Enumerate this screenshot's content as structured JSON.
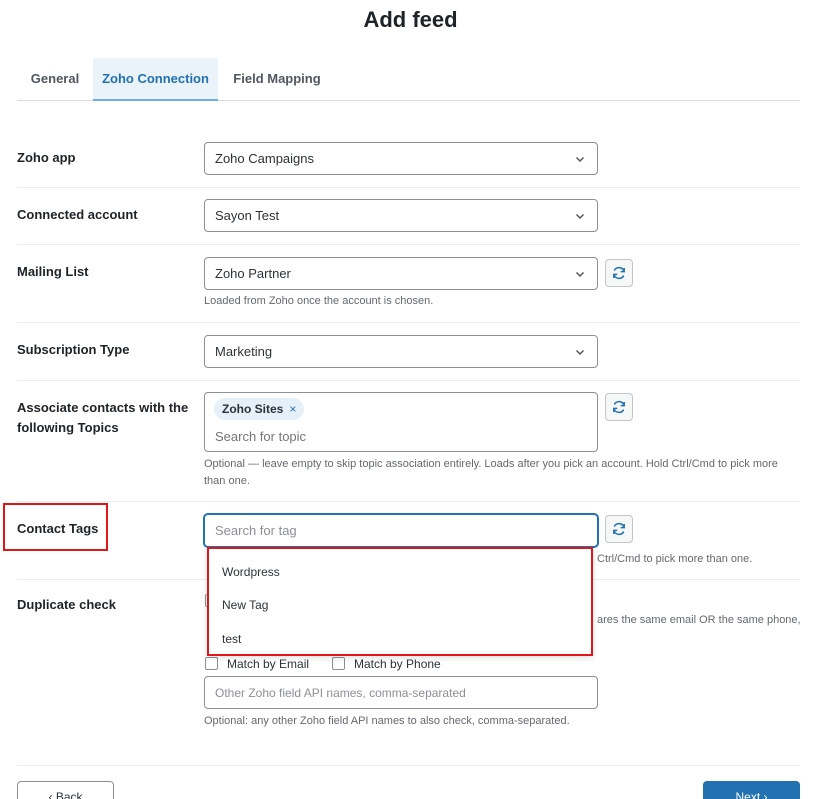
{
  "header": {
    "title": "Add feed"
  },
  "tabs": [
    {
      "label": "General"
    },
    {
      "label": "Zoho Connection"
    },
    {
      "label": "Field Mapping"
    }
  ],
  "fields": {
    "zoho_app": {
      "label": "Zoho app",
      "value": "Zoho Campaigns"
    },
    "connected_account": {
      "label": "Connected account",
      "value": "Sayon Test"
    },
    "mailing_list": {
      "label": "Mailing List",
      "value": "Zoho Partner",
      "help": "Loaded from Zoho once the account is chosen."
    },
    "subscription_type": {
      "label": "Subscription Type",
      "value": "Marketing"
    },
    "topics": {
      "label_line1": "Associate contacts with the",
      "label_line2": "following Topics",
      "chip": "Zoho Sites",
      "chip_remove": "×",
      "placeholder": "Search for topic",
      "help_line1": "Optional — leave empty to skip topic association entirely. Loads after you pick an account. Hold Ctrl/Cmd to pick more",
      "help_line2": "than one."
    },
    "contact_tags": {
      "label": "Contact Tags",
      "placeholder": "Search for tag",
      "help_visible": "Ctrl/Cmd to pick more than one.",
      "dropdown_options": [
        "Wordpress",
        "New Tag",
        "test"
      ]
    },
    "duplicate_check": {
      "label": "Duplicate check",
      "help_visible": "ares the same email OR the same phone,",
      "match_email": "Match by Email",
      "match_phone": "Match by Phone",
      "other_placeholder": "Other Zoho field API names, comma-separated",
      "other_help": "Optional: any other Zoho field API names to also check, comma-separated."
    }
  },
  "footer": {
    "back_label": "‹ Back",
    "next_label": "Next ›"
  },
  "colors": {
    "accent": "#2271b1",
    "highlight": "#e0161b",
    "tab_active_bg": "#eaf2fa"
  },
  "icons": {
    "chevron": "chevron-down-icon",
    "refresh": "refresh-icon"
  }
}
